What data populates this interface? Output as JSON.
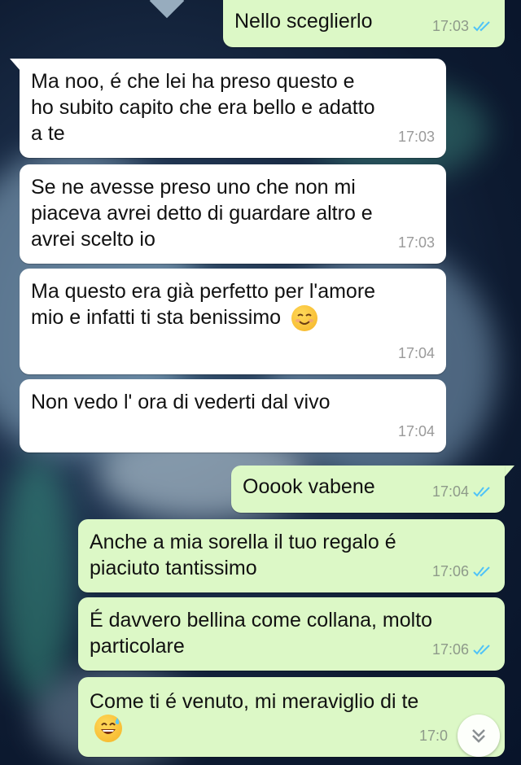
{
  "chat": {
    "messages": [
      {
        "direction": "outgoing",
        "text": "Nello sceglierlo",
        "time": "17:03",
        "status": "read"
      },
      {
        "direction": "incoming",
        "text": "Ma noo, é che lei ha preso questo e ho subito capito che era bello e adatto a te",
        "time": "17:03"
      },
      {
        "direction": "incoming",
        "text": "Se ne avesse preso uno che non mi piaceva avrei detto di guardare altro e avrei scelto io",
        "time": "17:03"
      },
      {
        "direction": "incoming",
        "text": "Ma questo era già perfetto per l'amore mio e infatti ti sta benissimo",
        "emoji": "smiling-face-icon",
        "time": "17:04"
      },
      {
        "direction": "incoming",
        "text": "Non vedo l' ora di vederti dal vivo",
        "time": "17:04"
      },
      {
        "direction": "outgoing",
        "text": "Ooook vabene",
        "time": "17:04",
        "status": "read"
      },
      {
        "direction": "outgoing",
        "text": "Anche a mia sorella il tuo regalo é piaciuto tantissimo",
        "time": "17:06",
        "status": "read"
      },
      {
        "direction": "outgoing",
        "text": "É davvero bellina come collana, molto particolare",
        "time": "17:06",
        "status": "read"
      },
      {
        "direction": "outgoing",
        "text": "Come ti é venuto, mi meraviglio di te",
        "emoji": "grinning-sweat-icon",
        "time": "17:0",
        "status": "read"
      }
    ]
  },
  "colors": {
    "incoming_bubble": "#ffffff",
    "outgoing_bubble": "#dcf8c6",
    "read_ticks": "#4fc3f7",
    "timestamp": "#9a9a9a"
  },
  "icons": {
    "read_receipt": "double-check-icon",
    "scroll_down": "chevron-double-down-icon"
  }
}
